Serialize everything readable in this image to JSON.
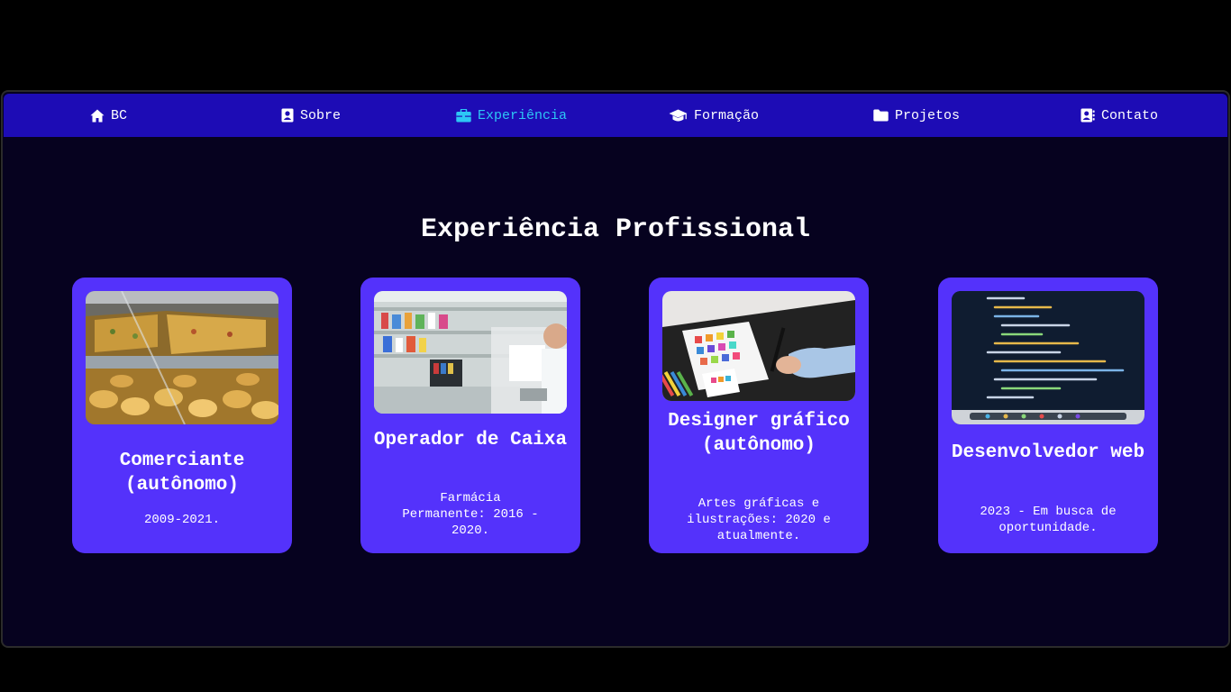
{
  "nav": {
    "items": [
      {
        "label": "BC",
        "icon": "home-icon"
      },
      {
        "label": "Sobre",
        "icon": "contact-card-icon"
      },
      {
        "label": "Experiência",
        "icon": "briefcase-icon"
      },
      {
        "label": "Formação",
        "icon": "graduation-cap-icon"
      },
      {
        "label": "Projetos",
        "icon": "folder-icon"
      },
      {
        "label": "Contato",
        "icon": "address-book-icon"
      }
    ],
    "active_index": 2
  },
  "section": {
    "title": "Experiência Profissional"
  },
  "cards": [
    {
      "title": "Comerciante (autônomo)",
      "description": "2009-2021.",
      "image": "bakery-display-photo"
    },
    {
      "title": "Operador de Caixa",
      "description": "Farmácia Permanente: 2016 - 2020.",
      "image": "pharmacy-counter-photo"
    },
    {
      "title": "Designer gráfico (autônomo)",
      "description": "Artes gráficas e ilustrações: 2020 e atualmente.",
      "image": "designer-drawing-photo"
    },
    {
      "title": "Desenvolvedor web",
      "description": "2023 - Em busca de oportunidade.",
      "image": "code-screen-photo"
    }
  ],
  "colors": {
    "page_background": "#000000",
    "content_background": "#06021f",
    "navbar_background": "#1d0cb5",
    "card_background": "#5432fb",
    "active_link": "#2dc7f5",
    "text": "#ffffff"
  }
}
